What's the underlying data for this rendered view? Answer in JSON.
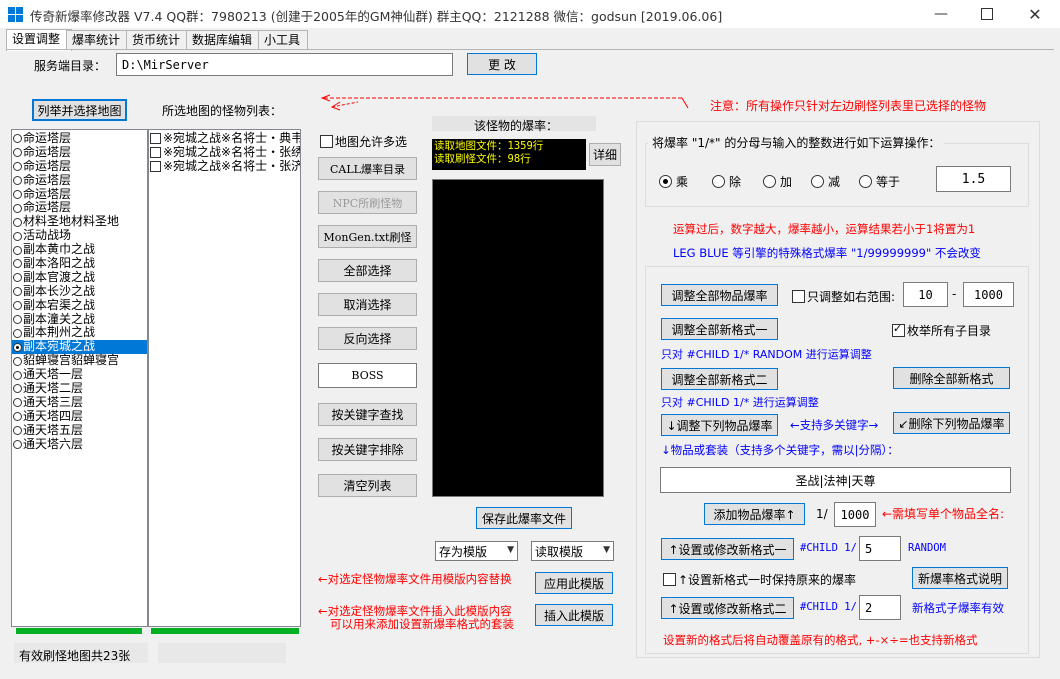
{
  "window": {
    "title": "传奇新爆率修改器 V7.4 QQ群：7980213 (创建于2005年的GM神仙群)   群主QQ：2121288  微信：godsun [2019.06.06]"
  },
  "tabs": [
    "设置调整",
    "爆率统计",
    "货币统计",
    "数据库编辑",
    "小工具"
  ],
  "server": {
    "label": "服务端目录：",
    "path": "D:\\MirServer",
    "change_button": "更  改"
  },
  "left": {
    "list_maps_button": "列举并选择地图",
    "monster_list_label": "所选地图的怪物列表：",
    "maps": [
      "命运塔层",
      "命运塔层",
      "命运塔层",
      "命运塔层",
      "命运塔层",
      "命运塔层",
      "材料圣地材料圣地",
      "活动战场",
      "副本黄巾之战",
      "副本洛阳之战",
      "副本官渡之战",
      "副本长沙之战",
      "副本宕渠之战",
      "副本潼关之战",
      "副本荆州之战",
      "副本宛城之战",
      "貂蝉寝宫貂蝉寝宫",
      "通天塔一层",
      "通天塔二层",
      "通天塔三层",
      "通天塔四层",
      "通天塔五层",
      "通天塔六层"
    ],
    "selected_map_index": 15,
    "monsters": [
      "※宛城之战※名将士・典韦",
      "※宛城之战※名将士・张绣",
      "※宛城之战※名将士・张济"
    ],
    "status": "有效刷怪地图共23张"
  },
  "middle": {
    "allow_multi_map": "地图允许多选",
    "buttons": [
      "CALL爆率目录",
      "NPC所刷怪物",
      "MonGen.txt刷怪",
      "全部选择",
      "取消选择",
      "反向选择"
    ],
    "boss_value": "BOSS",
    "buttons2": [
      "按关键字查找",
      "按关键字排除",
      "清空列表"
    ],
    "drop_rate_label": "该怪物的爆率：",
    "console": [
      "读取地图文件：1359行",
      "读取刷怪文件：98行"
    ],
    "detail_button": "详细",
    "save_button": "保存此爆率文件",
    "save_template_combo": "存为模版",
    "load_template_combo": "读取模版",
    "apply_template_button": "应用此模版",
    "insert_template_button": "插入此模版",
    "note_replace": "←对选定怪物爆率文件用模版内容替换",
    "note_insert_1": "←对选定怪物爆率文件插入此模版内容",
    "note_insert_2": "可以用来添加设置新爆率格式的套装"
  },
  "right": {
    "notice": "注意：所有操作只针对左边刷怪列表里已选择的怪物",
    "operation_label": "将爆率 \"1/*\" 的分母与输入的整数进行如下运算操作：",
    "ops": [
      "乘",
      "除",
      "加",
      "减",
      "等于"
    ],
    "selected_op": 0,
    "op_value": "1.5",
    "note_red": "运算过后，数字越大，爆率越小，运算结果若小于1将置为1",
    "note_blue": "LEG BLUE 等引擎的特殊格式爆率 \"1/99999999\" 不会改变",
    "adjust_all_button": "调整全部物品爆率",
    "range_check": "只调整如右范围:",
    "range_from": "10",
    "range_dash": "-",
    "range_to": "1000",
    "adjust_new1_button": "调整全部新格式一",
    "enum_subdir_check": "枚举所有子目录",
    "only_child_random": "只对 #CHILD 1/* RANDOM 进行运算调整",
    "adjust_new2_button": "调整全部新格式二",
    "delete_new_button": "删除全部新格式",
    "only_child": "只对 #CHILD 1/* 进行运算调整",
    "adjust_items_button": "↓调整下列物品爆率",
    "multi_keyword": "←支持多关键字→",
    "delete_items_button": "↙删除下列物品爆率",
    "items_label": "↓物品或套装（支持多个关键字，需以|分隔）：",
    "items_value": "圣战|法神|天尊",
    "add_item_button": "添加物品爆率↑",
    "add_prefix": "1/",
    "add_value": "1000",
    "add_note": "←需填写单个物品全名:",
    "set_new1_button": "↑设置或修改新格式一",
    "child_1": "#CHILD 1/",
    "new1_value": "5",
    "random": "RANDOM",
    "keep_check": "↑设置新格式一时保持原来的爆率",
    "explain_button": "新爆率格式说明",
    "set_new2_button": "↑设置或修改新格式二",
    "child_2": "#CHILD 1/",
    "new2_value": "2",
    "new2_note": "新格式子爆率有效",
    "bottom_note": "设置新的格式后将自动覆盖原有的格式, +-×÷=也支持新格式"
  },
  "colors": {
    "accent": "#0078d7",
    "progress": "#06b025",
    "warning": "#ff0000",
    "info": "#0000ff"
  }
}
